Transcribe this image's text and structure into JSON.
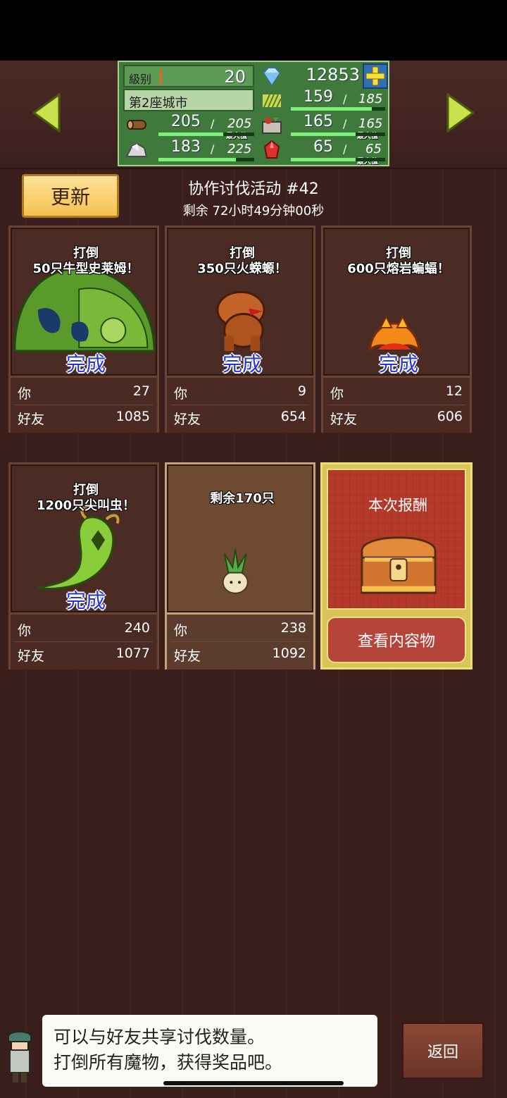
{
  "header": {
    "level_label": "級别",
    "level_value": "20",
    "gems": "12853",
    "city_name": "第2座城市",
    "resources": {
      "wheat": {
        "current": "159",
        "max": "185"
      },
      "wood": {
        "current": "205",
        "max": "205",
        "max_tag": "最大值"
      },
      "food": {
        "current": "165",
        "max": "165",
        "max_tag": "最大值"
      },
      "ore": {
        "current": "183",
        "max": "225"
      },
      "ruby": {
        "current": "65",
        "max": "65",
        "max_tag": "最大值"
      }
    },
    "separator": "/"
  },
  "event": {
    "refresh_label": "更新",
    "title": "协作讨伐活动 #42",
    "remaining": "剩余 72小时49分钟00秒"
  },
  "labels": {
    "you": "你",
    "friends": "好友",
    "done": "完成"
  },
  "quests": [
    {
      "line1": "打倒",
      "line2": "50只牛型史莱姆！",
      "status": "完成",
      "you": "27",
      "friends": "1085"
    },
    {
      "line1": "打倒",
      "line2": "350只火蝾螈！",
      "status": "完成",
      "you": "9",
      "friends": "654"
    },
    {
      "line1": "打倒",
      "line2": "600只熔岩蝙蝠！",
      "status": "完成",
      "you": "12",
      "friends": "606"
    },
    {
      "line1": "打倒",
      "line2": "1200只尖叫虫！",
      "status": "完成",
      "you": "240",
      "friends": "1077"
    },
    {
      "line1": "剩余170只",
      "line2": "",
      "status": "",
      "you": "238",
      "friends": "1092"
    }
  ],
  "reward": {
    "title": "本次报酬",
    "button": "查看内容物"
  },
  "dialog": {
    "line1": "可以与好友共享讨伐数量。",
    "line2": "打倒所有魔物，获得奖品吧。"
  },
  "back_label": "返回",
  "icons": [
    "arrow-left-icon",
    "arrow-right-icon",
    "diamond-icon",
    "plus-icon",
    "wheat-icon",
    "wood-icon",
    "food-icon",
    "ore-icon",
    "ruby-icon",
    "treasure-chest-icon",
    "character-icon"
  ],
  "colors": {
    "accent_green": "#3f7a3c",
    "button_gold": "#f5c14f",
    "done_blue": "#2536d8",
    "reward_red": "#b53a2a"
  }
}
